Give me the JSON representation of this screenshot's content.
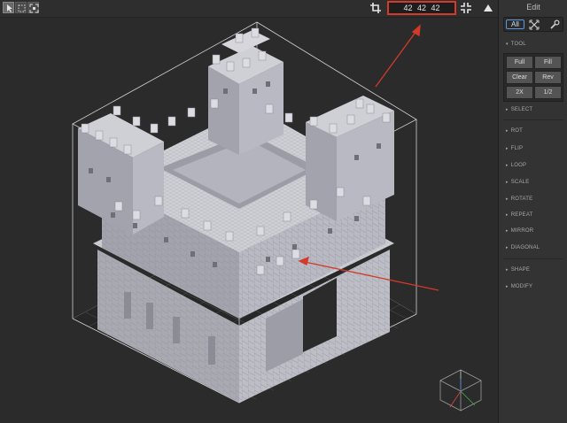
{
  "toolbar": {
    "dimensions": "42  42  42",
    "tools": [
      "select-tool",
      "box-select-tool",
      "center-select-tool"
    ]
  },
  "panel": {
    "title": "Edit",
    "tabs": {
      "all_label": "All"
    },
    "tool_section": {
      "label": "TOOL",
      "buttons": [
        "Full",
        "Fill",
        "Clear",
        "Rev",
        "2X",
        "1/2"
      ]
    },
    "sections": [
      "SELECT",
      "ROT",
      "FLIP",
      "LOOP",
      "SCALE",
      "ROTATE",
      "REPEAT",
      "MIRROR",
      "DIAGONAL",
      "SHAPE",
      "MODIFY"
    ]
  },
  "colors": {
    "accent_red": "#d23a2a",
    "tab_highlight": "#5a9ae0",
    "voxel_top": "#cfcfd6",
    "voxel_left": "#a3a3ad",
    "voxel_right": "#b9b9c3"
  },
  "icons": [
    "crop-icon",
    "fit-to-view-icon",
    "triangle-up-icon",
    "transform-icon",
    "wrench-icon",
    "orientation-cube-icon"
  ]
}
